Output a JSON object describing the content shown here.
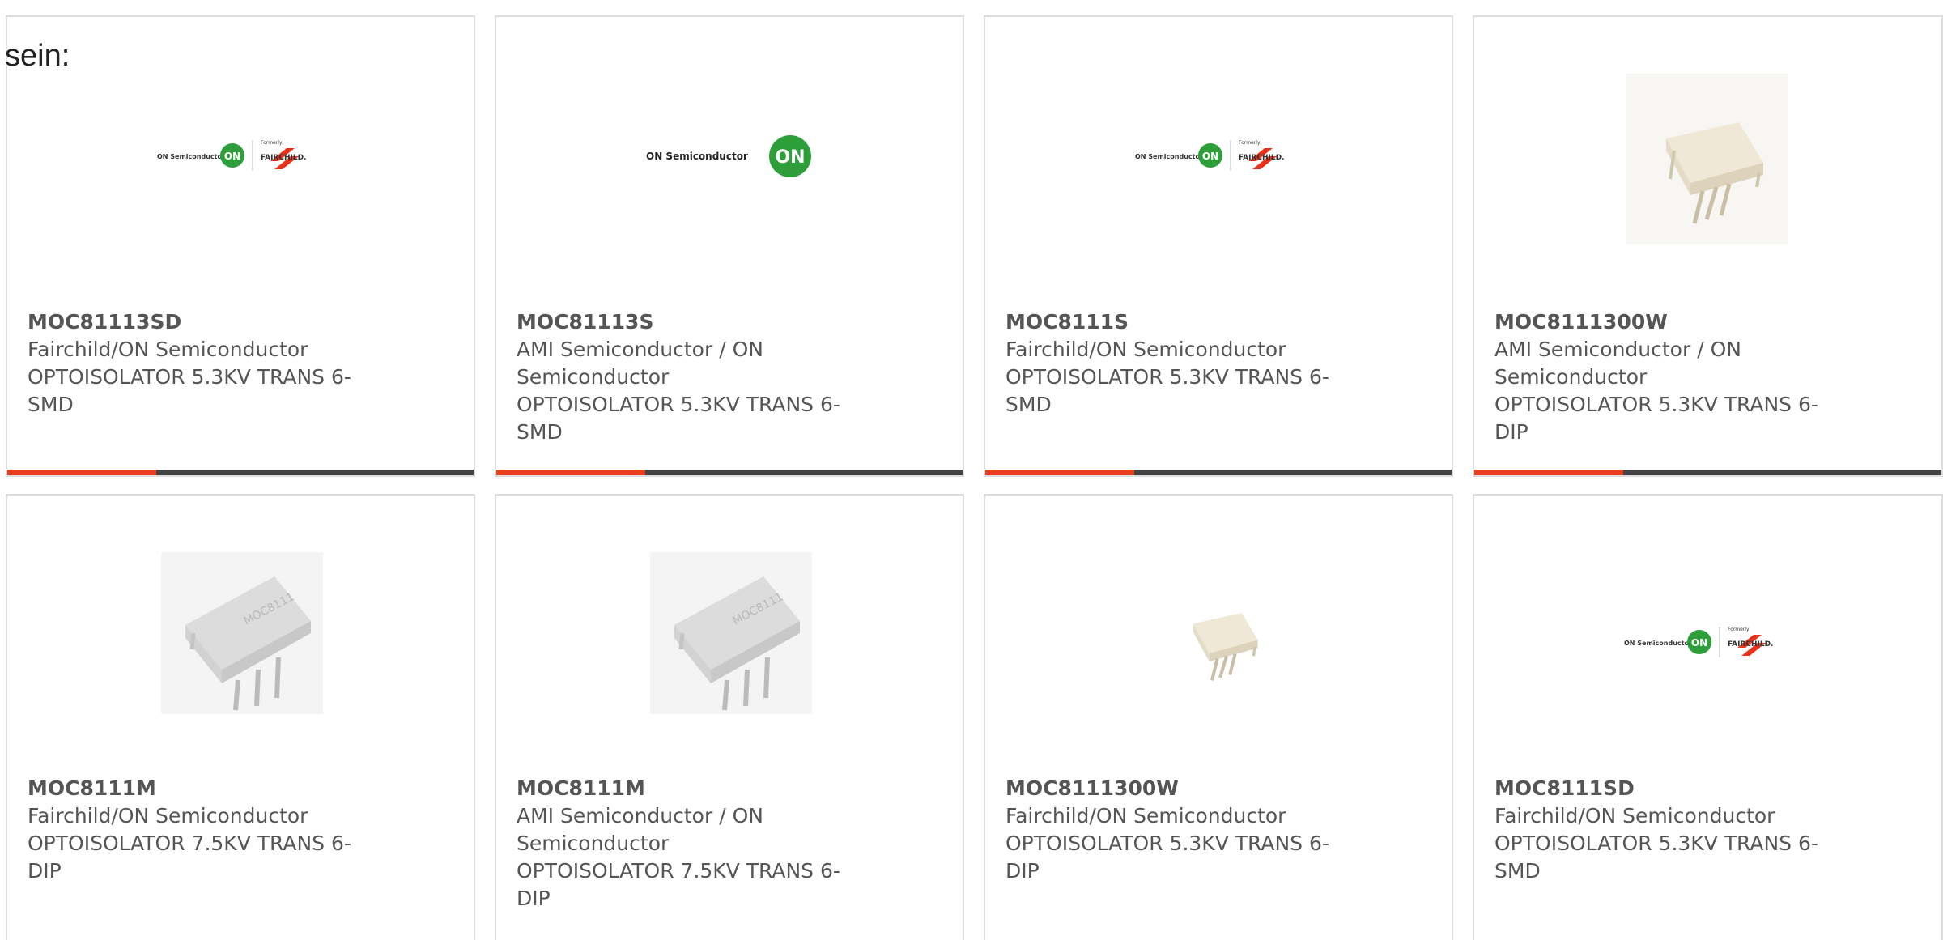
{
  "page": {
    "leading_text": "sein:"
  },
  "colors": {
    "accent": "#e8401c",
    "bar": "#444444",
    "border": "#dddddd",
    "on_green": "#2e9e3a",
    "fairchild_red": "#e8331c"
  },
  "products": [
    {
      "part_number": "MOC81113SD",
      "manufacturer": "Fairchild/ON Semiconductor",
      "description": "OPTOISOLATOR 5.3KV TRANS 6-SMD",
      "desc_line1": "OPTOISOLATOR 5.3KV TRANS 6-",
      "desc_line2": "SMD",
      "image": "on-fairchild-logo"
    },
    {
      "part_number": "MOC81113S",
      "manufacturer": "AMI Semiconductor / ON Semiconductor",
      "mfr_line1": "AMI Semiconductor / ON",
      "mfr_line2": "Semiconductor",
      "description": "OPTOISOLATOR 5.3KV TRANS 6-SMD",
      "desc_line1": "OPTOISOLATOR 5.3KV TRANS 6-",
      "desc_line2": "SMD",
      "image": "on-semiconductor-logo",
      "logo_text": "ON Semiconductor",
      "logo_mark": "ON"
    },
    {
      "part_number": "MOC8111S",
      "manufacturer": "Fairchild/ON Semiconductor",
      "description": "OPTOISOLATOR 5.3KV TRANS 6-SMD",
      "desc_line1": "OPTOISOLATOR 5.3KV TRANS 6-",
      "desc_line2": "SMD",
      "image": "on-fairchild-logo"
    },
    {
      "part_number": "MOC8111300W",
      "manufacturer": "AMI Semiconductor / ON Semiconductor",
      "mfr_line1": "AMI Semiconductor / ON",
      "mfr_line2": "Semiconductor",
      "description": "OPTOISOLATOR 5.3KV TRANS 6-DIP",
      "desc_line1": "OPTOISOLATOR 5.3KV TRANS 6-",
      "desc_line2": "DIP",
      "image": "beige-dip-package"
    },
    {
      "part_number": "MOC8111M",
      "manufacturer": "Fairchild/ON Semiconductor",
      "description": "OPTOISOLATOR 7.5KV TRANS 6-DIP",
      "desc_line1": "OPTOISOLATOR 7.5KV TRANS 6-",
      "desc_line2": "DIP",
      "image": "grey-dip-package",
      "chip_marking": "MOC8111"
    },
    {
      "part_number": "MOC8111M",
      "manufacturer": "AMI Semiconductor / ON Semiconductor",
      "mfr_line1": "AMI Semiconductor / ON",
      "mfr_line2": "Semiconductor",
      "description": "OPTOISOLATOR 7.5KV TRANS 6-DIP",
      "desc_line1": "OPTOISOLATOR 7.5KV TRANS 6-",
      "desc_line2": "DIP",
      "image": "grey-dip-package",
      "chip_marking": "MOC8111"
    },
    {
      "part_number": "MOC8111300W",
      "manufacturer": "Fairchild/ON Semiconductor",
      "description": "OPTOISOLATOR 5.3KV TRANS 6-DIP",
      "desc_line1": "OPTOISOLATOR 5.3KV TRANS 6-",
      "desc_line2": "DIP",
      "image": "beige-dip-package"
    },
    {
      "part_number": "MOC8111SD",
      "manufacturer": "Fairchild/ON Semiconductor",
      "description": "OPTOISOLATOR 5.3KV TRANS 6-SMD",
      "desc_line1": "OPTOISOLATOR 5.3KV TRANS 6-",
      "desc_line2": "SMD",
      "image": "on-fairchild-logo"
    }
  ],
  "logos": {
    "on_fairchild": {
      "left_text": "ON Semiconductor",
      "mark": "ON",
      "formerly": "Formerly",
      "brand": "FAIRCHILD."
    }
  }
}
